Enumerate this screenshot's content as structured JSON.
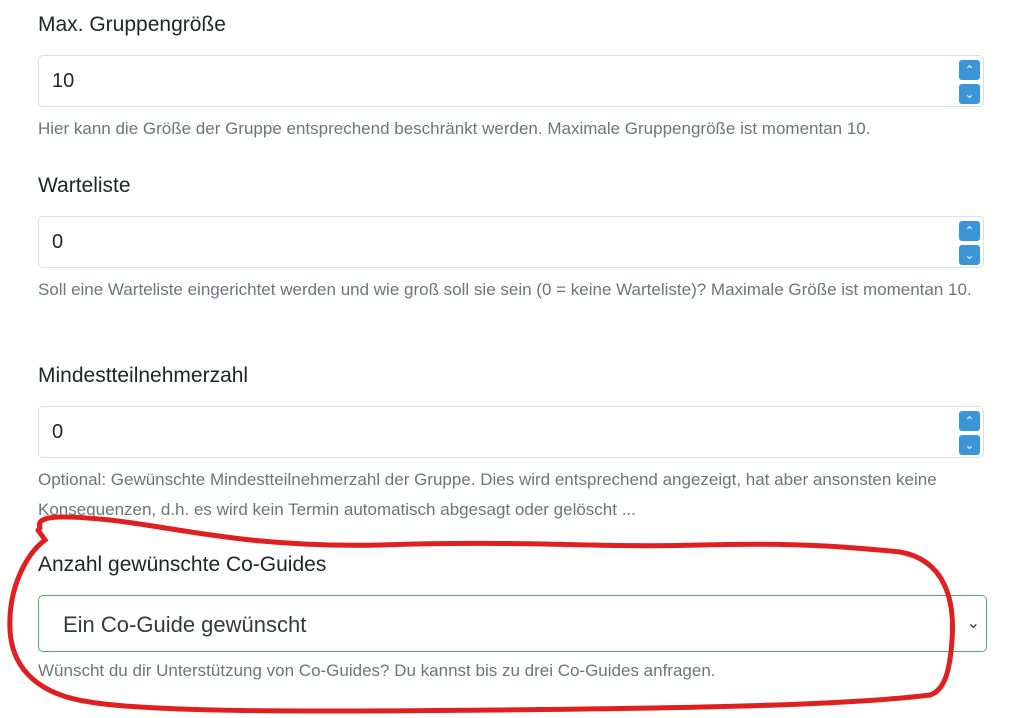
{
  "fields": [
    {
      "label": "Max. Gruppengröße",
      "value": "10",
      "help": "Hier kann die Größe der Gruppe entsprechend beschränkt werden. Maximale Gruppengröße ist momentan 10."
    },
    {
      "label": "Warteliste",
      "value": "0",
      "help": "Soll eine Warteliste eingerichtet werden und wie groß soll sie sein (0 = keine Warteliste)? Maximale Größe ist momentan 10."
    },
    {
      "label": "Mindestteilnehmerzahl",
      "value": "0",
      "help": "Optional: Gewünschte Mindestteilnehmerzahl der Gruppe. Dies wird entsprechend angezeigt, hat aber ansonsten keine Konsequenzen, d.h. es wird kein Termin automatisch abgesagt oder gelöscht ..."
    }
  ],
  "coguides": {
    "label": "Anzahl gewünschte Co-Guides",
    "selected": "Ein Co-Guide gewünscht",
    "help": "Wünscht du dir Unterstützung von Co-Guides? Du kannst bis zu drei Co-Guides anfragen."
  },
  "colors": {
    "annotation": "#e02020",
    "spinner": "#3a96d8",
    "select_border": "#4caf6a"
  }
}
